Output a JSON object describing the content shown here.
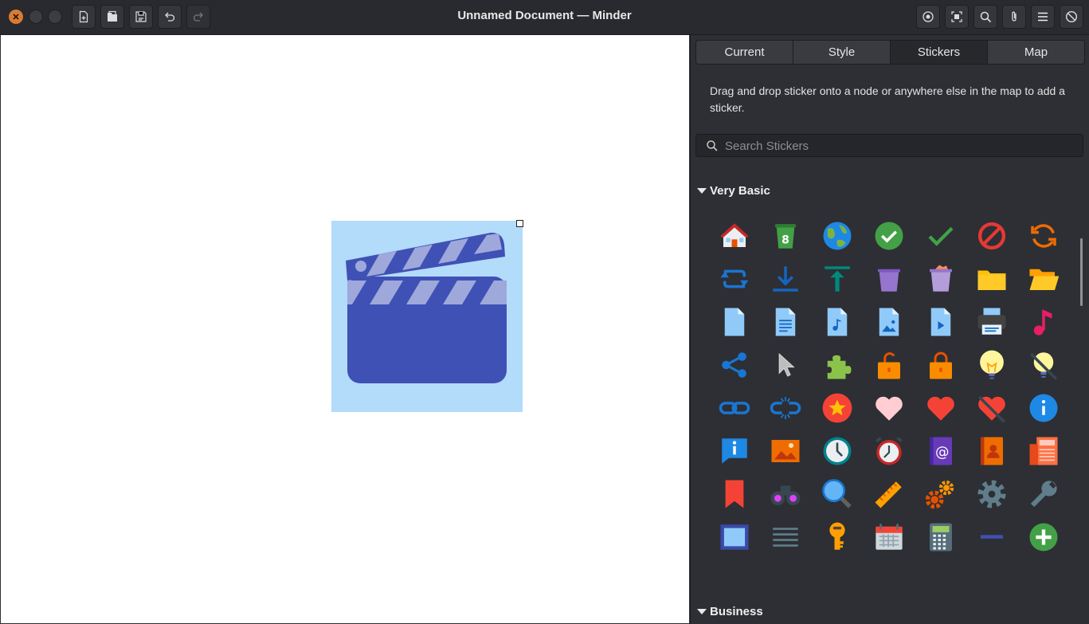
{
  "window": {
    "title": "Unnamed Document — Minder",
    "controls": [
      "close",
      "minimize",
      "maximize"
    ]
  },
  "toolbar_left": [
    "new-document-icon",
    "open-document-icon",
    "save-as-icon",
    "undo-icon",
    "redo-icon"
  ],
  "toolbar_right": [
    "focus-mode-icon",
    "zoom-fit-icon",
    "search-icon",
    "attach-icon",
    "menu-icon",
    "disable-icon"
  ],
  "canvas": {
    "node_sticker": "clapperboard-icon",
    "node_bg": "#b3dbfa"
  },
  "sidebar": {
    "tabs": [
      {
        "label": "Current"
      },
      {
        "label": "Style"
      },
      {
        "label": "Stickers"
      },
      {
        "label": "Map"
      }
    ],
    "active_tab": "Stickers",
    "description": "Drag and drop sticker onto a node or anywhere else in the map to add a sticker.",
    "search": {
      "placeholder": "Search Stickers",
      "value": ""
    },
    "categories": [
      {
        "label": "Very Basic",
        "expanded": true
      },
      {
        "label": "Business",
        "expanded": true
      }
    ],
    "stickers": [
      "home",
      "recycle",
      "globe",
      "check-circle",
      "check",
      "forbidden",
      "refresh",
      "sync",
      "download",
      "upload",
      "trash-empty",
      "trash-full",
      "folder",
      "folder-open",
      "document",
      "document-text",
      "document-audio",
      "document-image",
      "document-video",
      "printer",
      "music",
      "share",
      "cursor",
      "puzzle",
      "unlock",
      "lock",
      "bulb-on",
      "bulb-off",
      "link",
      "unlink",
      "star",
      "heart-empty",
      "heart",
      "heart-broken",
      "info",
      "info-bubble",
      "picture",
      "clock",
      "alarm",
      "address-book",
      "contact",
      "newspaper",
      "bookmark",
      "binoculars",
      "magnifier",
      "ruler",
      "gears",
      "gear",
      "wrench",
      "frame",
      "lines",
      "key",
      "calendar",
      "calculator",
      "minus",
      "plus"
    ]
  },
  "colors": {
    "accent_close": "#d97c33",
    "titlebar": "#282a2f",
    "sidebar": "#2d2f34"
  }
}
